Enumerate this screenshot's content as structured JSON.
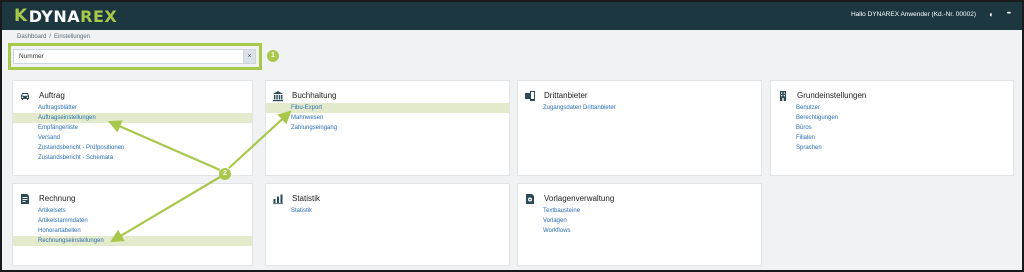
{
  "header": {
    "logo_k": "K",
    "logo_dyna": "DYNA",
    "logo_rex": "REX",
    "user_text": "Hallo DYNAREX Anwender (Kd.-Nr. 00002)",
    "help_icon": "◐",
    "menu_icon": "•••"
  },
  "breadcrumb": {
    "home": "Dashboard",
    "separator": "/",
    "current": "Einstellungen"
  },
  "search": {
    "value": "Nummer",
    "clear_icon": "×"
  },
  "markers": {
    "one": "1",
    "two": "2"
  },
  "colors": {
    "topbar": "#1d3741",
    "accent": "#a7c84b",
    "link": "#2a6db5",
    "highlight_row": "#e3ebcc"
  },
  "cards": {
    "auftrag": {
      "title": "Auftrag",
      "icon": "car-icon",
      "links": [
        "Auftragsblätter",
        "Auftragseinstellungen",
        "Empfängerliste",
        "Versand",
        "Zustandsbericht - Prüfpositionen",
        "Zustandsbericht - Schemata"
      ]
    },
    "buchhaltung": {
      "title": "Buchhaltung",
      "icon": "bank-icon",
      "links": [
        "Fibu-Export",
        "Mahnwesen",
        "Zahlungseingang"
      ]
    },
    "drittanbieter": {
      "title": "Drittanbieter",
      "icon": "devices-icon",
      "links": [
        "Zugangsdaten Drittanbieter"
      ]
    },
    "grundeinstellungen": {
      "title": "Grundeinstellungen",
      "icon": "building-icon",
      "links": [
        "Benutzer",
        "Berechtigungen",
        "Büros",
        "Filialen",
        "Sprachen"
      ]
    },
    "rechnung": {
      "title": "Rechnung",
      "icon": "invoice-icon",
      "links": [
        "Artikelsets",
        "Artikelstammdaten",
        "Honorartabellen",
        "Rechnungseinstellungen"
      ]
    },
    "statistik": {
      "title": "Statistik",
      "icon": "bar-chart-icon",
      "links": [
        "Statistik"
      ]
    },
    "vorlagen": {
      "title": "Vorlagenverwaltung",
      "icon": "template-icon",
      "links": [
        "Textbausteine",
        "Vorlagen",
        "Workflows"
      ]
    }
  }
}
